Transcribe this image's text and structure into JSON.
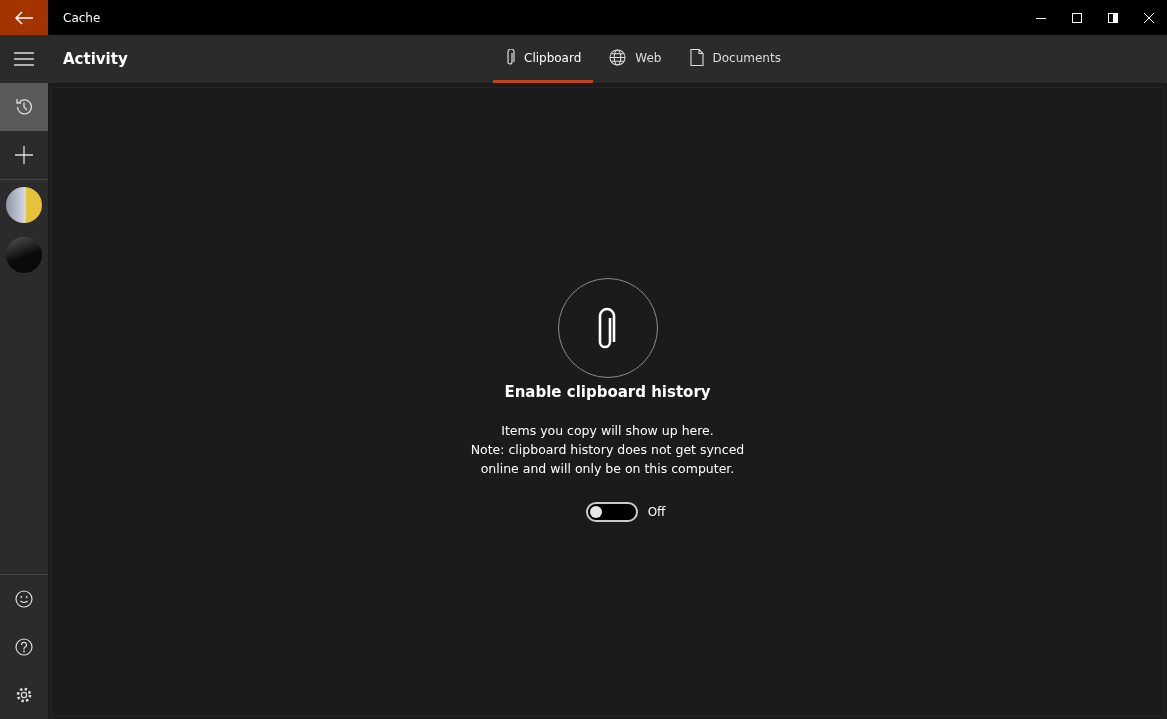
{
  "window": {
    "title": "Cache"
  },
  "header": {
    "title": "Activity"
  },
  "tabs": [
    {
      "label": "Clipboard",
      "kind": "clipboard",
      "selected": true
    },
    {
      "label": "Web",
      "kind": "web",
      "selected": false
    },
    {
      "label": "Documents",
      "kind": "documents",
      "selected": false
    }
  ],
  "sidebar": {
    "items": [
      {
        "kind": "history",
        "selected": true
      },
      {
        "kind": "add",
        "selected": false
      }
    ],
    "accounts": [
      {
        "kind": "light"
      },
      {
        "kind": "dark"
      }
    ],
    "footer": [
      {
        "kind": "feedback"
      },
      {
        "kind": "help"
      },
      {
        "kind": "settings"
      }
    ]
  },
  "empty_state": {
    "title": "Enable clipboard history",
    "lines": [
      "Items you copy will show up here.",
      "Note: clipboard history does not get synced online and will only be on this computer."
    ],
    "toggle": {
      "on": false,
      "label": "Off"
    }
  }
}
